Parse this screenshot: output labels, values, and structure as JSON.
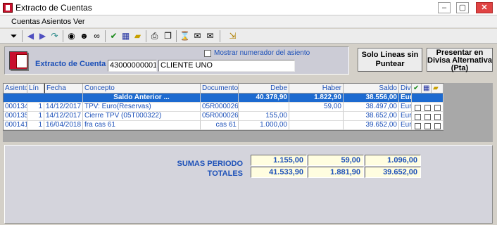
{
  "window": {
    "title": "Extracto de Cuentas",
    "min": "‒",
    "max": "▢",
    "close": "✕"
  },
  "menu": [
    "Cuentas",
    "Asientos",
    "Ver"
  ],
  "toolbar_icons": [
    "filter-icon",
    "arrow-left-icon",
    "arrow-right-icon",
    "redo-icon",
    "search-icon",
    "find-person-icon",
    "binoculars-icon",
    "check-icon",
    "chart-icon",
    "folder-icon",
    "print-icon",
    "copy-icon",
    "hourglass-icon",
    "mail-icon",
    "mail-open-icon",
    "exit-icon"
  ],
  "header": {
    "extracto_label": "Extracto de Cuenta",
    "account_code": "43000000001",
    "account_name": "CLIENTE UNO",
    "mostrar_label": "Mostrar numerador del asiento",
    "mostrar_checked": false
  },
  "buttons": {
    "solo_lineas": [
      "Solo Lineas sin",
      "Puntear"
    ],
    "presentar": [
      "Presentar en",
      "Divisa Alternativa",
      "(Pta)"
    ]
  },
  "grid": {
    "columns": [
      "Asiento",
      "Lín",
      "Fecha",
      "Concepto",
      "Documento",
      "Debe",
      "Haber",
      "Saldo",
      "Div"
    ],
    "saldo_anterior": {
      "concepto": "Saldo Anterior ...",
      "debe": "40.378,90",
      "haber": "1.822,90",
      "saldo": "38.556,00",
      "div": "Eur"
    },
    "rows": [
      {
        "asiento": "000134",
        "lin": "1",
        "fecha": "14/12/2017",
        "concepto": "TPV: Euro(Reservas)",
        "documento": "05R000026",
        "debe": "",
        "haber": "59,00",
        "saldo": "38.497,00",
        "div": "Eur"
      },
      {
        "asiento": "000135",
        "lin": "1",
        "fecha": "14/12/2017",
        "concepto": "Cierre TPV (05T000322)",
        "documento": "05R000026",
        "debe": "155,00",
        "haber": "",
        "saldo": "38.652,00",
        "div": "Eur"
      },
      {
        "asiento": "000141",
        "lin": "1",
        "fecha": "16/04/2018",
        "concepto": "fra cas 61",
        "documento": "cas 61",
        "debe": "1.000,00",
        "haber": "",
        "saldo": "39.652,00",
        "div": "Eur"
      }
    ]
  },
  "sums": {
    "periodo_label": "SUMAS PERIODO",
    "periodo": [
      "1.155,00",
      "59,00",
      "1.096,00"
    ],
    "totales_label": "TOTALES",
    "totales": [
      "41.533,90",
      "1.881,90",
      "39.652,00"
    ]
  }
}
